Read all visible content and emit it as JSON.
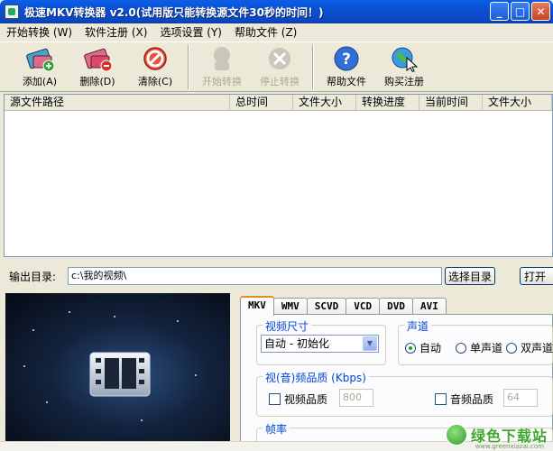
{
  "window": {
    "title": "极速MKV转换器 v2.0(试用版只能转换源文件30秒的时间！)"
  },
  "menu": [
    "开始转换 (W)",
    "软件注册 (X)",
    "选项设置 (Y)",
    "帮助文件 (Z)"
  ],
  "toolbar": {
    "add": "添加(A)",
    "remove": "删除(D)",
    "clear": "清除(C)",
    "start": "开始转换",
    "stop": "停止转换",
    "help": "帮助文件",
    "buy": "购买注册"
  },
  "list": {
    "columns": [
      "源文件路径",
      "总时间",
      "文件大小",
      "转换进度",
      "当前时间",
      "文件大小"
    ]
  },
  "output": {
    "label": "输出目录:",
    "path": "c:\\我的视频\\",
    "browse": "选择目录",
    "open": "打开"
  },
  "tabs": [
    "MKV",
    "WMV",
    "SCVD",
    "VCD",
    "DVD",
    "AVI"
  ],
  "settings": {
    "video_size_title": "视频尺寸",
    "video_size_value": "自动 - 初始化",
    "channel_title": "声道",
    "channel_auto": "自动",
    "channel_mono": "单声道",
    "channel_stereo": "双声道",
    "quality_title": "视(音)频品质 (Kbps)",
    "video_quality_label": "视频品质",
    "video_quality_value": "800",
    "audio_quality_label": "音频品质",
    "audio_quality_value": "64",
    "framerate_title": "帧率"
  },
  "watermark": {
    "text": "绿色下载站",
    "sub": "www.greenxiazai.com"
  }
}
